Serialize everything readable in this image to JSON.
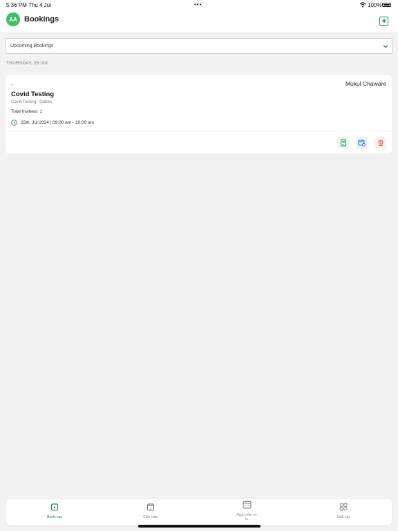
{
  "status_bar": {
    "time": "5:36 PM",
    "date": "Thu 4 Jul",
    "dots": "•••",
    "battery": "100%"
  },
  "header": {
    "avatar_initials": "AA",
    "title": "Bookings"
  },
  "filter": {
    "selected": "Upcoming Bookings"
  },
  "section": {
    "date_heading": "THURSDAY, 25 JUL"
  },
  "booking": {
    "dash": "-",
    "host": "Mukul Chaware",
    "title": "Covid Testing",
    "subtitle": "Covid Testing - Qubec",
    "invitees": "Total Invitees: 1",
    "datetime": "25th, Jul 2024 | 09:00 am - 10:00 am"
  },
  "tabs": [
    {
      "label": "Booki ngs",
      "icon": "bookings-icon",
      "active": true
    },
    {
      "label": "Cale ndar",
      "icon": "calendar-icon",
      "active": false
    },
    {
      "label": "Appo intm ents",
      "icon": "appointments-icon",
      "active": false
    },
    {
      "label": "Setti ngs",
      "icon": "settings-grid-icon",
      "active": false
    }
  ],
  "colors": {
    "accent": "#1f8a55",
    "avatar": "#3fbf6a",
    "reschedule": "#2f7fc4",
    "delete": "#e05a5a"
  }
}
